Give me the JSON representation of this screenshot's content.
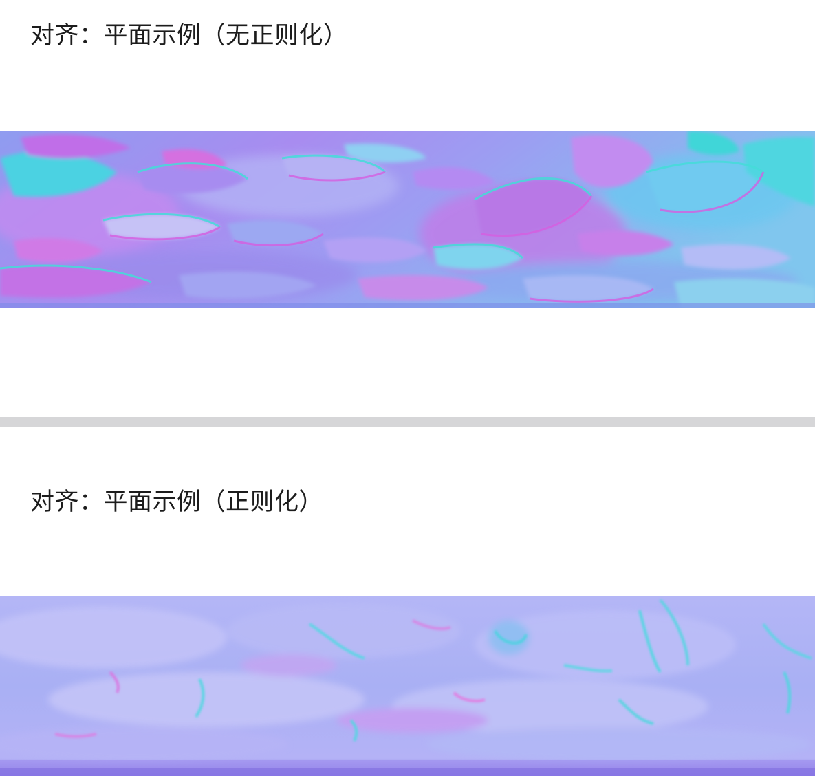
{
  "panels": [
    {
      "caption": "对齐：平面示例（无正则化）",
      "image": {
        "kind": "normal-map-render",
        "colors": [
          "#9c8af0",
          "#c05ae0",
          "#4ad8e0",
          "#6fb4f0",
          "#b9a6f2"
        ]
      }
    },
    {
      "caption": "对齐：平面示例（正则化）",
      "image": {
        "kind": "normal-map-render",
        "colors": [
          "#a8aef6",
          "#b888f0",
          "#62d6e6",
          "#c2c0f8",
          "#8c7ae6"
        ]
      }
    }
  ]
}
